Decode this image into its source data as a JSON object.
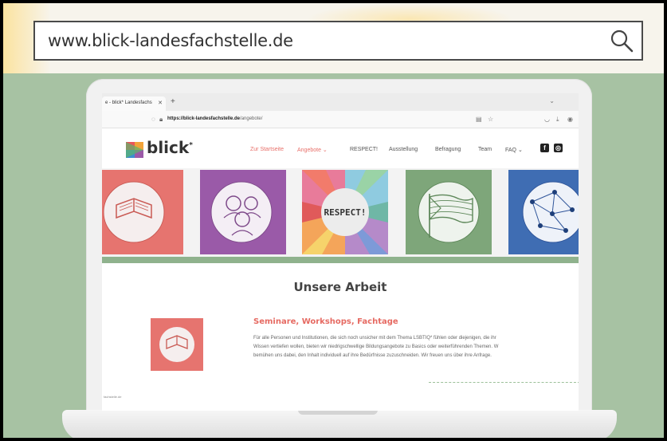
{
  "outer": {
    "url_display": "www.blick-landesfachstelle.de"
  },
  "browser": {
    "tab_title": "e - blick* Landesfachs",
    "url_host": "https://blick-landesfachstelle.de",
    "url_path": "/angebote/"
  },
  "site": {
    "logo": "blick",
    "logo_sup": "*",
    "nav": [
      {
        "label": "Zur Startseite",
        "active": true
      },
      {
        "label": "Angebote ⌄",
        "active": true
      },
      {
        "label": "RESPECT!",
        "active": false
      },
      {
        "label": "Ausstellung",
        "active": false
      },
      {
        "label": "Befragung",
        "active": false
      },
      {
        "label": "Team",
        "active": false
      },
      {
        "label": "FAQ ⌄",
        "active": false
      }
    ],
    "hero_respect": "RESPECT!",
    "section_title": "Unsere Arbeit",
    "card": {
      "title": "Seminare, Workshops, Fachtage",
      "lines": [
        "Für alle Personen und Institutionen, die sich noch unsicher mit dem Thema LSBTIQ* fühlen oder diejenigen, die ihr",
        "Wissen vertiefen wollen, bieten wir niedrigschwellige Bildungsangebote zu Basics oder weiterführenden Themen. W",
        "bemühen uns dabei, den Inhalt individuell auf ihre Bedürfnisse zuzuschneiden. Wir freuen uns über ihre Anfrage."
      ]
    },
    "status": "fachstelle.de"
  },
  "colors": {
    "green_bg": "#a7c2a3",
    "accent_red": "#e8706a",
    "purple": "#9a5aa8",
    "green_tile": "#7ea67a",
    "blue_tile": "#3f6db3"
  }
}
